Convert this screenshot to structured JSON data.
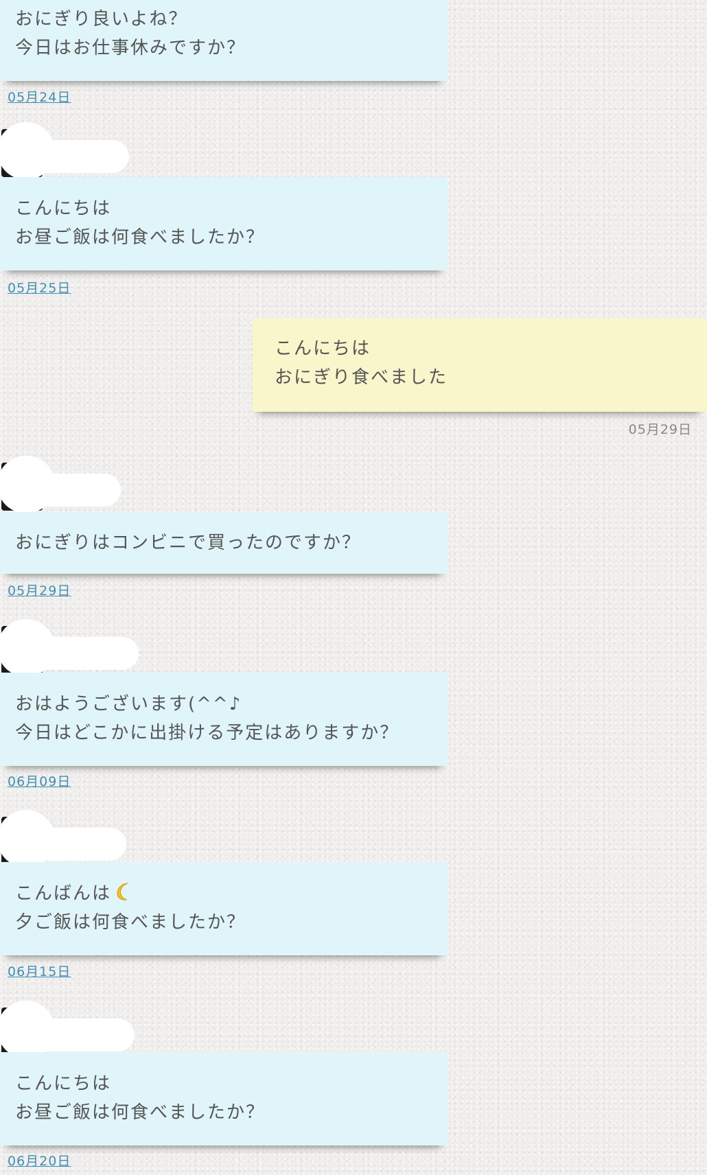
{
  "messages": [
    {
      "lines": [
        "おにぎり良いよね？",
        "今日はお仕事休みですか？"
      ],
      "date": "05月24日"
    },
    {
      "lines": [
        "こんにちは",
        "お昼ご飯は何食べましたか？"
      ],
      "date": "05月25日"
    },
    {
      "lines": [
        "こんにちは",
        "おにぎり食べました"
      ],
      "date": "05月29日"
    },
    {
      "lines": [
        "おにぎりはコンビニで買ったのですか？"
      ],
      "date": "05月29日"
    },
    {
      "lines": [
        "おはようございます(^^♪",
        "今日はどこかに出掛ける予定はありますか？"
      ],
      "date": "06月09日"
    },
    {
      "lines": [
        "こんばんは",
        "夕ご飯は何食べましたか？"
      ],
      "date": "06月15日"
    },
    {
      "lines": [
        "こんにちは",
        "お昼ご飯は何食べましたか？"
      ],
      "date": "06月20日"
    }
  ]
}
